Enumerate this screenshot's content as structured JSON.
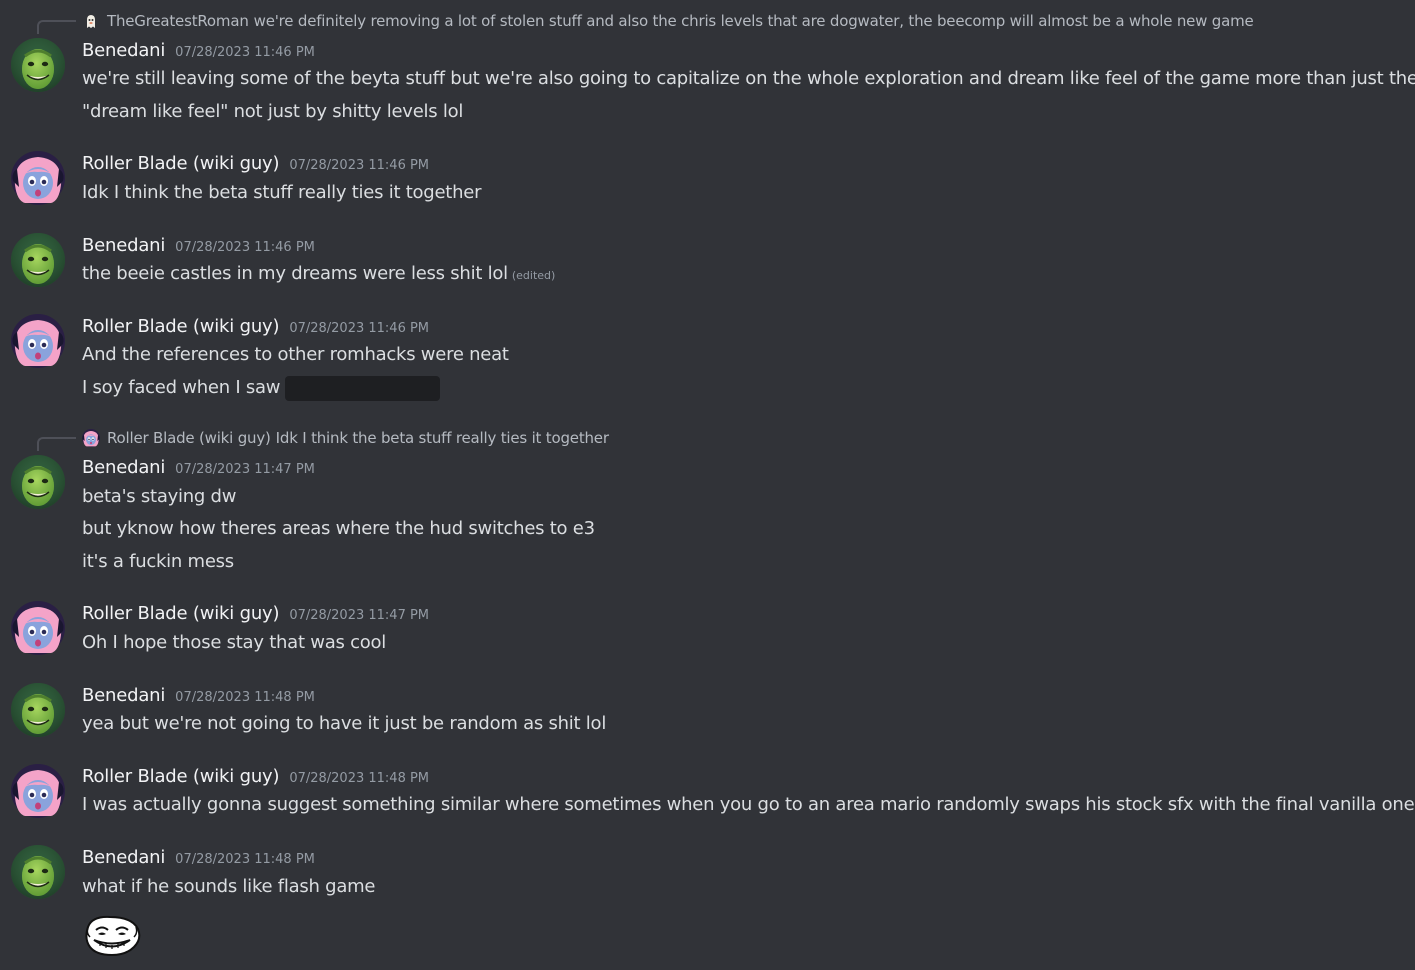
{
  "reply_1": {
    "author": "TheGreatestRoman",
    "text": "we're definitely removing a lot of stolen stuff and also the chris levels that are dogwater, the beecomp will almost be a whole new game",
    "avatar_icon": "ghost-avatar"
  },
  "reply_2": {
    "author": "Roller Blade (wiki guy)",
    "text": "Idk I think the beta stuff really ties it together",
    "avatar_icon": "roller-blade-avatar"
  },
  "messages": [
    {
      "author": "Benedani",
      "timestamp": "07/28/2023 11:46 PM",
      "avatar_icon": "benedani-avatar",
      "lines": [
        "we're still leaving some of the beyta stuff but we're also going to capitalize on the whole exploration and dream like feel of the game more than just the beyta",
        "\"dream like feel\" not just by shitty levels lol"
      ]
    },
    {
      "author": "Roller Blade (wiki guy)",
      "timestamp": "07/28/2023 11:46 PM",
      "avatar_icon": "roller-blade-avatar",
      "lines": [
        "Idk I think the beta stuff really ties it together"
      ]
    },
    {
      "author": "Benedani",
      "timestamp": "07/28/2023 11:46 PM",
      "avatar_icon": "benedani-avatar",
      "lines": [
        "the beeie castles in my dreams were less shit lol"
      ],
      "edited_label": "(edited)"
    },
    {
      "author": "Roller Blade (wiki guy)",
      "timestamp": "07/28/2023 11:46 PM",
      "avatar_icon": "roller-blade-avatar",
      "lines": [
        "And the references to other romhacks were neat",
        "I soy faced when I saw"
      ],
      "spoiler": "hidden-spoiler"
    },
    {
      "author": "Benedani",
      "timestamp": "07/28/2023 11:47 PM",
      "avatar_icon": "benedani-avatar",
      "lines": [
        "beta's staying dw",
        "but yknow how theres areas where the hud switches to e3",
        "it's a fuckin mess"
      ]
    },
    {
      "author": "Roller Blade (wiki guy)",
      "timestamp": "07/28/2023 11:47 PM",
      "avatar_icon": "roller-blade-avatar",
      "lines": [
        "Oh I hope those stay that was cool"
      ]
    },
    {
      "author": "Benedani",
      "timestamp": "07/28/2023 11:48 PM",
      "avatar_icon": "benedani-avatar",
      "lines": [
        "yea but we're not going to have it just be random as shit lol"
      ]
    },
    {
      "author": "Roller Blade (wiki guy)",
      "timestamp": "07/28/2023 11:48 PM",
      "avatar_icon": "roller-blade-avatar",
      "lines": [
        "I was actually gonna suggest something similar where sometimes when you go to an area mario randomly swaps his stock sfx with the final vanilla ones"
      ]
    },
    {
      "author": "Benedani",
      "timestamp": "07/28/2023 11:48 PM",
      "avatar_icon": "benedani-avatar",
      "lines": [
        "what if he sounds like flash game"
      ],
      "emoji": "trollface-emoji"
    }
  ],
  "colors": {
    "background": "#313338",
    "author": "#f2f3f5",
    "text": "#dbdee1",
    "muted": "#949ba4",
    "spoiler": "#1e1f22"
  }
}
